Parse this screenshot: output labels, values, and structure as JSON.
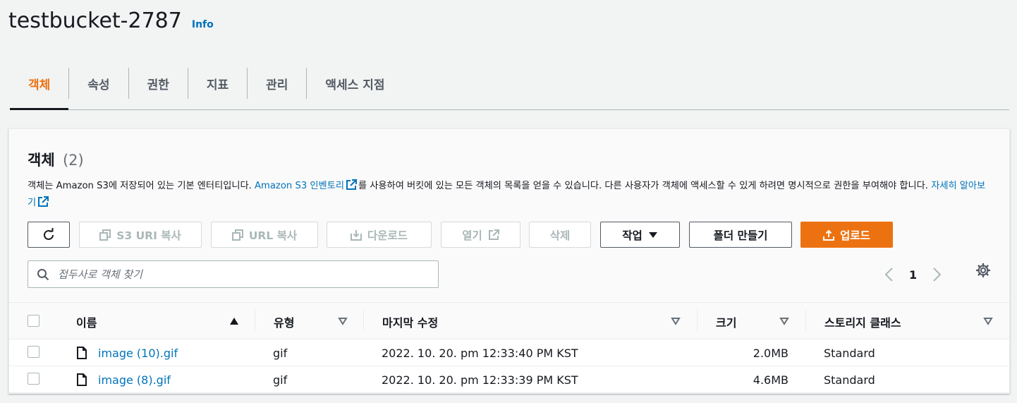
{
  "header": {
    "title": "testbucket-2787",
    "info_label": "Info"
  },
  "tabs": [
    {
      "label": "객체",
      "active": true
    },
    {
      "label": "속성"
    },
    {
      "label": "권한"
    },
    {
      "label": "지표"
    },
    {
      "label": "관리"
    },
    {
      "label": "액세스 지점"
    }
  ],
  "panel": {
    "title": "객체",
    "count": "(2)",
    "desc_part1": "객체는 Amazon S3에 저장되어 있는 기본 엔터티입니다. ",
    "desc_link1": "Amazon S3 인벤토리",
    "desc_part2": "를 사용하여 버킷에 있는 모든 객체의 목록을 얻을 수 있습니다. 다른 사용자가 객체에 액세스할 수 있게 하려면 명시적으로 권한을 부여해야 합니다. ",
    "desc_link2": "자세히 알아보기"
  },
  "toolbar": {
    "copy_s3_uri": "S3 URI 복사",
    "copy_url": "URL 복사",
    "download": "다운로드",
    "open": "열기",
    "delete": "삭제",
    "actions": "작업",
    "create_folder": "폴더 만들기",
    "upload": "업로드"
  },
  "search": {
    "placeholder": "접두사로 객체 찾기"
  },
  "pagination": {
    "current_page": "1"
  },
  "table": {
    "columns": [
      "이름",
      "유형",
      "마지막 수정",
      "크기",
      "스토리지 클래스"
    ],
    "rows": [
      {
        "name": "image (10).gif",
        "type": "gif",
        "modified": "2022. 10. 20. pm 12:33:40 PM KST",
        "size": "2.0MB",
        "storage_class": "Standard"
      },
      {
        "name": "image (8).gif",
        "type": "gif",
        "modified": "2022. 10. 20. pm 12:33:39 PM KST",
        "size": "4.6MB",
        "storage_class": "Standard"
      }
    ]
  },
  "colors": {
    "accent": "#ec7211",
    "link": "#0073bb",
    "text": "#16191f"
  }
}
